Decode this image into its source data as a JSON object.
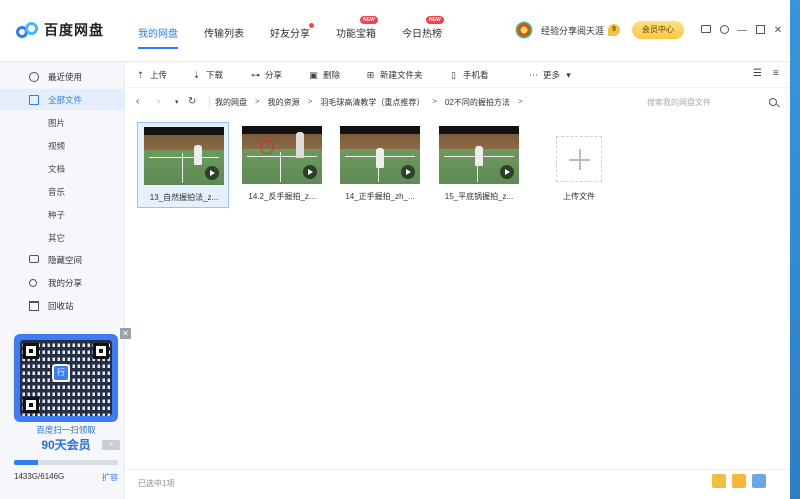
{
  "app": {
    "title": "百度网盘"
  },
  "topnav": [
    {
      "label": "我的网盘",
      "active": true
    },
    {
      "label": "传输列表"
    },
    {
      "label": "好友分享",
      "dot": true
    },
    {
      "label": "功能宝箱",
      "badge": "NEW"
    },
    {
      "label": "今日热榜",
      "badge": "NEW"
    }
  ],
  "user": {
    "name": "经验分享阅天涯",
    "level": "8",
    "vip_button": "会员中心"
  },
  "sidebar": {
    "items": [
      {
        "label": "最近使用",
        "icon": "clock-icon"
      },
      {
        "label": "全部文件",
        "icon": "file-icon",
        "active": true
      },
      {
        "label": "图片",
        "sub": true
      },
      {
        "label": "视频",
        "sub": true
      },
      {
        "label": "文档",
        "sub": true
      },
      {
        "label": "音乐",
        "sub": true
      },
      {
        "label": "种子",
        "sub": true
      },
      {
        "label": "其它",
        "sub": true
      },
      {
        "label": "隐藏空间",
        "icon": "lock-icon"
      },
      {
        "label": "我的分享",
        "icon": "share-icon"
      },
      {
        "label": "回收站",
        "icon": "trash-icon"
      }
    ],
    "promo": {
      "line1": "百度扫一扫领取",
      "line2": "90天会员",
      "qr_logo": "行"
    },
    "storage": {
      "used_text": "1433G/6146G",
      "expand": "扩容",
      "fraction": 0.233
    }
  },
  "toolbar": {
    "upload": "上传",
    "download": "下载",
    "share": "分享",
    "delete": "删除",
    "new_folder": "新建文件夹",
    "phone": "手机看",
    "more": "更多"
  },
  "breadcrumb": {
    "items": [
      "我的网盘",
      "我的资源",
      "羽毛球高清教学（重点推荐）",
      "02不同的握拍方法"
    ],
    "search_placeholder": "搜索我的网盘文件"
  },
  "files": [
    {
      "name": "13_自然握拍法_z...",
      "selected": true
    },
    {
      "name": "14.2_反手握拍_z..."
    },
    {
      "name": "14_正手握拍_zh_..."
    },
    {
      "name": "15_平底锅握拍_z..."
    }
  ],
  "upload_label": "上传文件",
  "status": {
    "text": "已选中1项"
  }
}
